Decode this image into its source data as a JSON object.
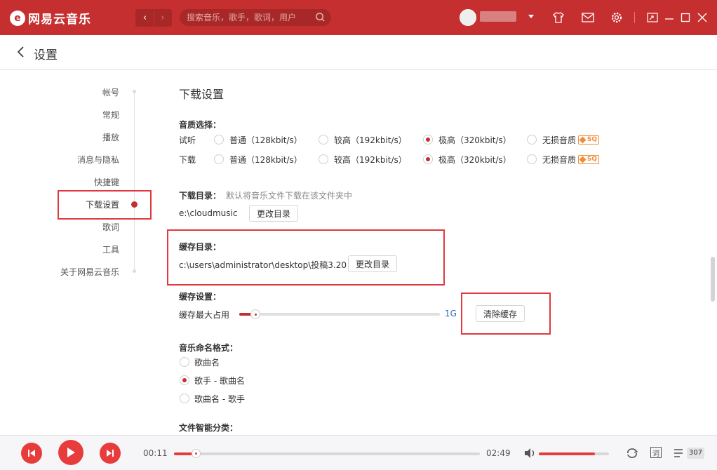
{
  "app": {
    "name": "网易云音乐",
    "logo_glyph": "e"
  },
  "topbar": {
    "search_placeholder": "搜索音乐，歌手，歌词，用户",
    "icons": [
      "back-arrow-icon",
      "forward-arrow-icon",
      "search-icon",
      "caret-down-icon",
      "tshirt-icon",
      "mail-icon",
      "gear-icon",
      "mini-mode-icon",
      "minimize-icon",
      "maximize-icon",
      "close-icon"
    ],
    "accent": "#c62f2f"
  },
  "header": {
    "title": "设置"
  },
  "sidebar": {
    "items": [
      {
        "label": "帐号"
      },
      {
        "label": "常规"
      },
      {
        "label": "播放"
      },
      {
        "label": "消息与隐私"
      },
      {
        "label": "快捷键"
      },
      {
        "label": "下载设置",
        "active": true
      },
      {
        "label": "歌词"
      },
      {
        "label": "工具"
      },
      {
        "label": "关于网易云音乐"
      }
    ]
  },
  "download": {
    "title": "下载设置",
    "quality_label": "音质选择：",
    "rows": [
      {
        "label": "试听",
        "options": [
          "普通（128kbit/s）",
          "较高（192kbit/s）",
          "极高（320kbit/s）",
          "无损音质"
        ],
        "selected": 2
      },
      {
        "label": "下载",
        "options": [
          "普通（128kbit/s）",
          "较高（192kbit/s）",
          "极高（320kbit/s）",
          "无损音质"
        ],
        "selected": 2
      }
    ],
    "sq_badge": "SQ",
    "dir_label": "下载目录：",
    "dir_hint": "默认将音乐文件下载在该文件夹中",
    "dir_path": "e:\\cloudmusic",
    "change_dir": "更改目录"
  },
  "cache": {
    "dir_label": "缓存目录：",
    "dir_path": "c:\\users\\administrator\\desktop\\投稿3.20",
    "change_dir": "更改目录",
    "settings_label": "缓存设置：",
    "max_label": "缓存最大占用",
    "max_value": "1G",
    "slider_fraction": 0.08,
    "clear_button": "清除缓存"
  },
  "naming": {
    "label": "音乐命名格式：",
    "options": [
      "歌曲名",
      "歌手 - 歌曲名",
      "歌曲名 - 歌手"
    ],
    "selected": 1
  },
  "smart_sort": {
    "label": "文件智能分类："
  },
  "player": {
    "current_time": "00:11",
    "total_time": "02:49",
    "progress_fraction": 0.07,
    "volume_fraction": 0.8,
    "lyric_label": "词",
    "playlist_count": "307"
  }
}
